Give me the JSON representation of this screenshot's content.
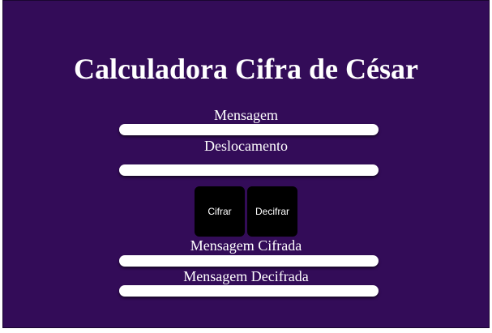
{
  "page": {
    "title": "Calculadora Cifra de César",
    "background_color": "#330c58"
  },
  "form": {
    "message_label": "Mensagem",
    "message_value": "",
    "shift_label": "Deslocamento",
    "shift_value": "",
    "encrypted_label": "Mensagem Cifrada",
    "encrypted_value": "",
    "decrypted_label": "Mensagem Decifrada",
    "decrypted_value": ""
  },
  "buttons": {
    "encrypt_label": "Cifrar",
    "decrypt_label": "Decifrar"
  }
}
